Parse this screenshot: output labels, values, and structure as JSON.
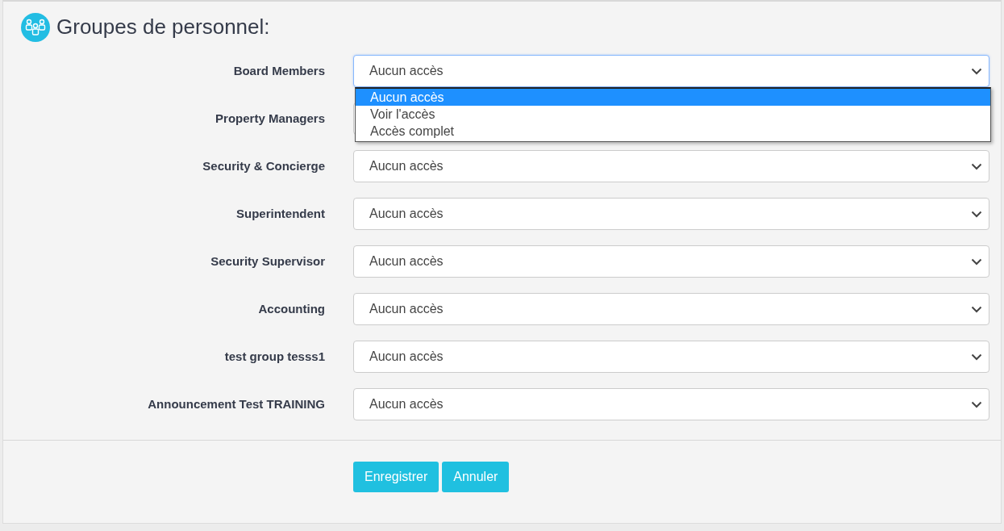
{
  "title": "Groupes de personnel:",
  "groups": [
    {
      "label": "Board Members",
      "value": "Aucun accès",
      "open": true
    },
    {
      "label": "Property Managers",
      "open": false
    },
    {
      "label": "Security & Concierge",
      "value": "Aucun accès",
      "open": false
    },
    {
      "label": "Superintendent",
      "value": "Aucun accès",
      "open": false
    },
    {
      "label": "Security Supervisor",
      "value": "Aucun accès",
      "open": false
    },
    {
      "label": "Accounting",
      "value": "Aucun accès",
      "open": false
    },
    {
      "label": "test group tesss1",
      "value": "Aucun accès",
      "open": false
    },
    {
      "label": "Announcement Test TRAINING",
      "value": "Aucun accès",
      "open": false
    }
  ],
  "dropdown_options": [
    {
      "label": "Aucun accès",
      "selected": true
    },
    {
      "label": "Voir l'accès",
      "selected": false
    },
    {
      "label": "Accès complet",
      "selected": false
    }
  ],
  "buttons": [
    "Enregistrer",
    "Annuler"
  ]
}
